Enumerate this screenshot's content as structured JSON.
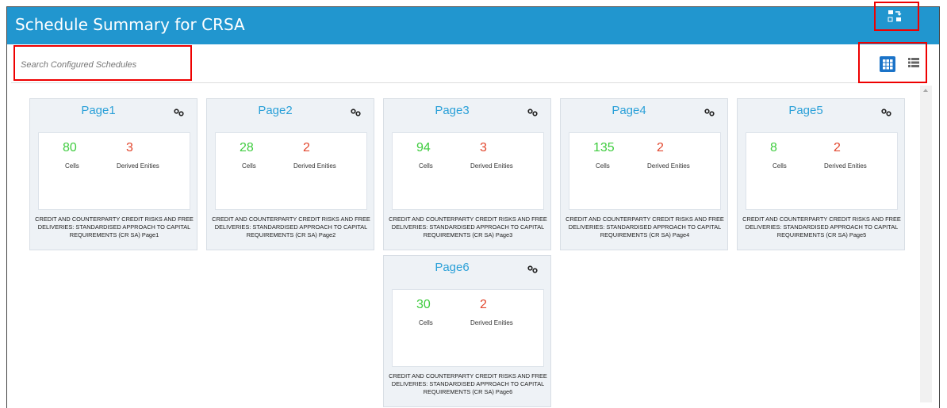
{
  "header": {
    "title": "Schedule Summary for CRSA",
    "bg_color": "#2196cf",
    "action_icon": "mapping-icon"
  },
  "search": {
    "placeholder": "Search Configured Schedules",
    "value": ""
  },
  "view_toggle": {
    "active": "grid",
    "grid_icon": "grid-view-icon",
    "list_icon": "list-view-icon"
  },
  "cards": [
    {
      "title": "Page1",
      "cells": "80",
      "derived": "3",
      "cells_label": "Cells",
      "derived_label": "Derived Enities",
      "description": "CREDIT AND COUNTERPARTY CREDIT RISKS AND FREE DELIVERIES: STANDARDISED APPROACH TO CAPITAL REQUIREMENTS (CR SA) Page1"
    },
    {
      "title": "Page2",
      "cells": "28",
      "derived": "2",
      "cells_label": "Cells",
      "derived_label": "Derived Enities",
      "description": "CREDIT AND COUNTERPARTY CREDIT RISKS AND FREE DELIVERIES: STANDARDISED APPROACH TO CAPITAL REQUIREMENTS (CR SA) Page2"
    },
    {
      "title": "Page3",
      "cells": "94",
      "derived": "3",
      "cells_label": "Cells",
      "derived_label": "Derived Enities",
      "description": "CREDIT AND COUNTERPARTY CREDIT RISKS AND FREE DELIVERIES: STANDARDISED APPROACH TO CAPITAL REQUIREMENTS (CR SA) Page3"
    },
    {
      "title": "Page4",
      "cells": "135",
      "derived": "2",
      "cells_label": "Cells",
      "derived_label": "Derived Enities",
      "description": "CREDIT AND COUNTERPARTY CREDIT RISKS AND FREE DELIVERIES: STANDARDISED APPROACH TO CAPITAL REQUIREMENTS (CR SA) Page4"
    },
    {
      "title": "Page5",
      "cells": "8",
      "derived": "2",
      "cells_label": "Cells",
      "derived_label": "Derived Enities",
      "description": "CREDIT AND COUNTERPARTY CREDIT RISKS AND FREE DELIVERIES: STANDARDISED APPROACH TO CAPITAL REQUIREMENTS (CR SA) Page5"
    },
    {
      "title": "Page6",
      "cells": "30",
      "derived": "2",
      "cells_label": "Cells",
      "derived_label": "Derived Enities",
      "description": "CREDIT AND COUNTERPARTY CREDIT RISKS AND FREE DELIVERIES: STANDARDISED APPROACH TO CAPITAL REQUIREMENTS (CR SA) Page6"
    }
  ],
  "colors": {
    "cells": "#3fcc3f",
    "derived": "#e2472e",
    "card_title": "#2aa0d8",
    "highlight": "#ee0000"
  }
}
